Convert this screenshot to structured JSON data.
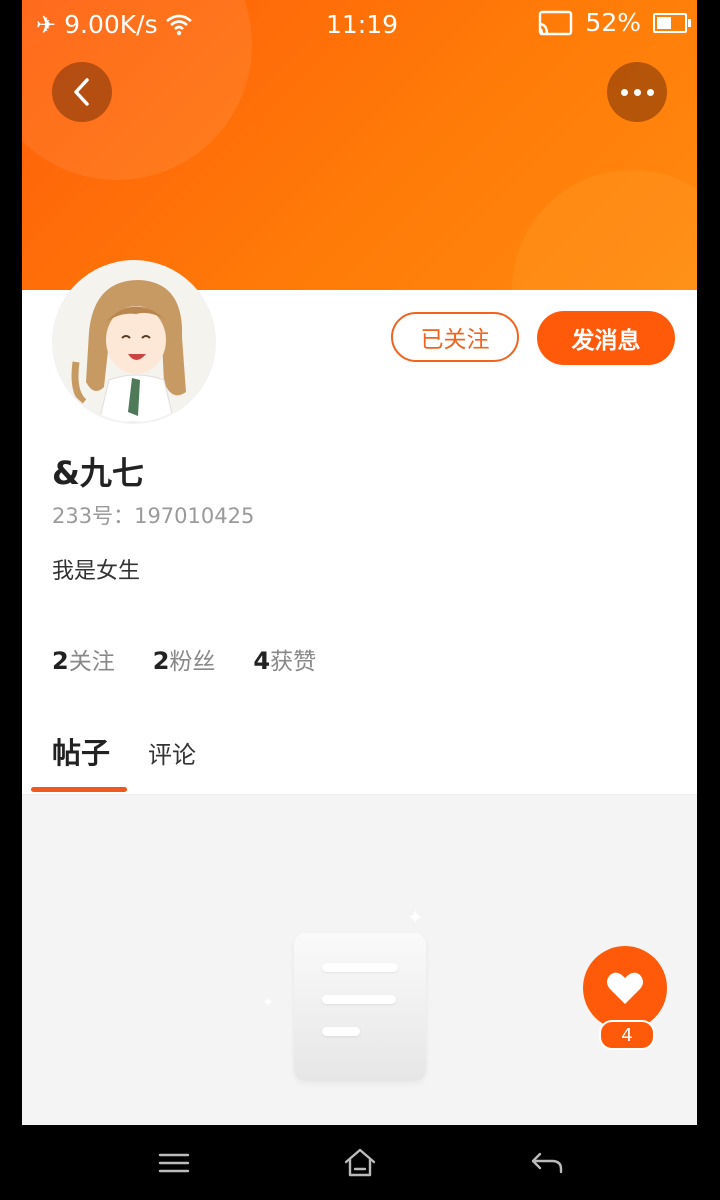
{
  "status_bar": {
    "network_speed": "9.00K/s",
    "time": "11:19",
    "battery": "52%",
    "battery_level": 0.52
  },
  "profile": {
    "name": "&九七",
    "id_line": "233号：197010425",
    "bio": "我是女生",
    "follow_button": "已关注",
    "message_button": "发消息"
  },
  "stats": [
    {
      "count": "2",
      "label": "关注"
    },
    {
      "count": "2",
      "label": "粉丝"
    },
    {
      "count": "4",
      "label": "获赞"
    }
  ],
  "tabs": [
    {
      "label": "帖子",
      "active": true
    },
    {
      "label": "评论",
      "active": false
    }
  ],
  "like_fab": {
    "count": "4"
  },
  "colors": {
    "accent": "#ff5a0a",
    "header_start": "#ff5e0a",
    "header_end": "#ff8a10"
  }
}
